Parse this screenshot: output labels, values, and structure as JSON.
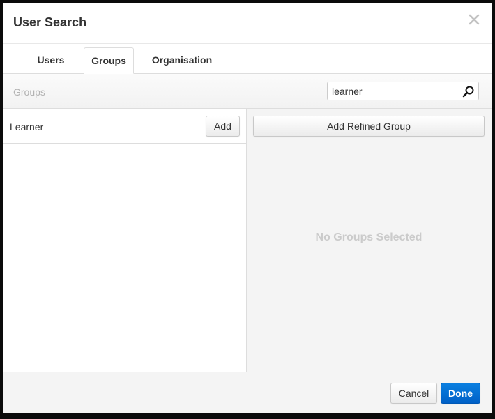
{
  "dialog": {
    "title": "User Search",
    "close_icon": "close-icon"
  },
  "tabs": [
    {
      "label": "Users",
      "active": false
    },
    {
      "label": "Groups",
      "active": true
    },
    {
      "label": "Organisation",
      "active": false
    }
  ],
  "toolbar": {
    "label": "Groups",
    "search": {
      "value": "learner",
      "icon": "search-icon"
    }
  },
  "results": {
    "items": [
      {
        "label": "Learner",
        "action": "Add"
      }
    ]
  },
  "selection": {
    "add_refined_label": "Add Refined Group",
    "empty_message": "No Groups Selected"
  },
  "footer": {
    "cancel_label": "Cancel",
    "done_label": "Done"
  },
  "colors": {
    "primary": "#0a6fd6",
    "empty_text": "#cbcbcb"
  }
}
